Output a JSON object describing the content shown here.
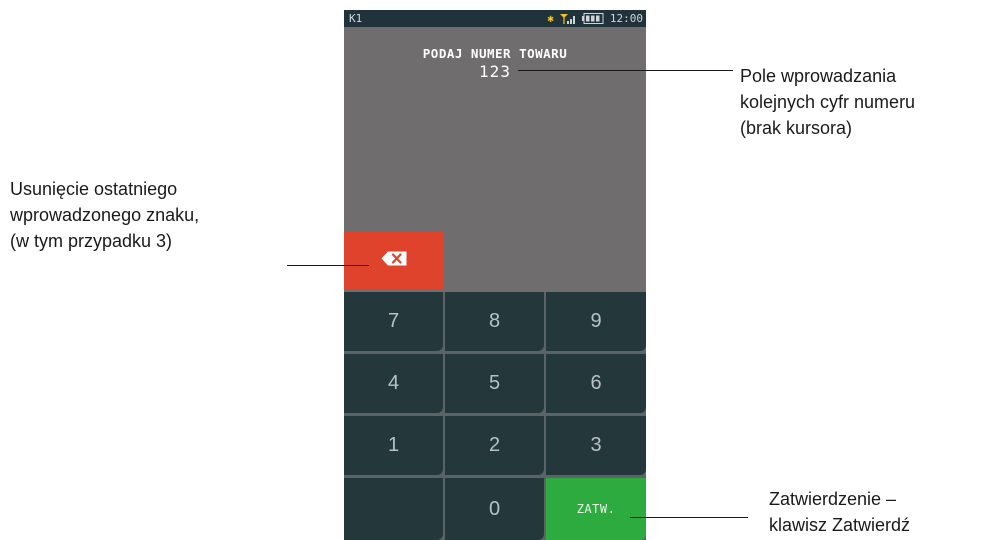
{
  "statusbar": {
    "mode": "K1",
    "bluetooth_icon": "bluetooth-icon",
    "signal_icon": "signal-icon",
    "battery_icon": "battery-icon",
    "time": "12:00"
  },
  "screen": {
    "prompt": "PODAJ NUMER TOWARU",
    "entry_value": "123"
  },
  "backspace": {
    "icon": "backspace-icon",
    "color": "#e0432b"
  },
  "keypad": {
    "keys": [
      {
        "label": "7"
      },
      {
        "label": "8"
      },
      {
        "label": "9"
      },
      {
        "label": "4"
      },
      {
        "label": "5"
      },
      {
        "label": "6"
      },
      {
        "label": "1"
      },
      {
        "label": "2"
      },
      {
        "label": "3"
      },
      {
        "label": ""
      },
      {
        "label": "0"
      },
      {
        "label": "ZATW."
      }
    ],
    "confirm_color": "#2dab3f",
    "key_color": "#24373b"
  },
  "annotations": {
    "left": [
      "Usunięcie ostatniego",
      "wprowadzonego znaku,",
      "(w tym przypadku 3)"
    ],
    "right_top": [
      "Pole wprowadzania",
      "kolejnych cyfr numeru",
      "(brak kursora)"
    ],
    "right_bottom": [
      "Zatwierdzenie –",
      "klawisz Zatwierdź"
    ]
  }
}
